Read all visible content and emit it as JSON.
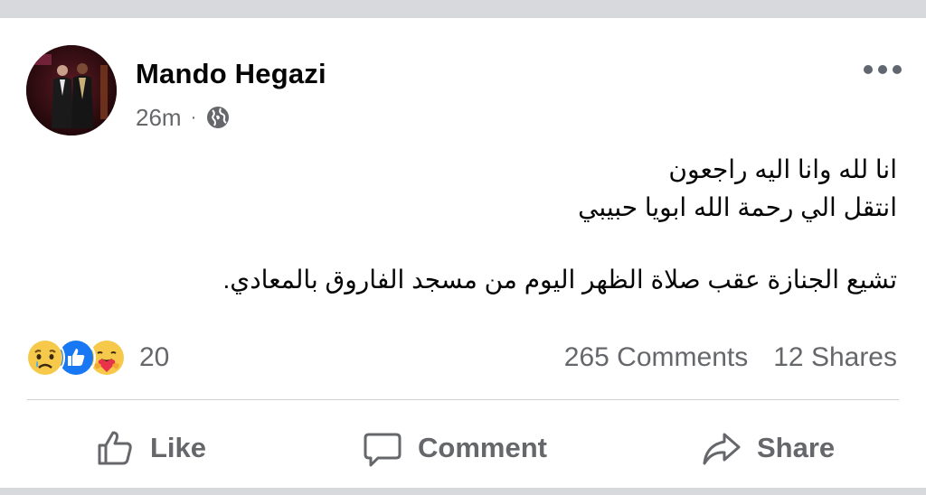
{
  "post": {
    "author_name": "Mando Hegazi",
    "timestamp": "26m",
    "separator": "·",
    "privacy_icon": "globe-icon",
    "more_icon": "more-options-icon",
    "lines": [
      "انا لله وانا اليه راجعون",
      "انتقل الي رحمة الله ابويا حبيبي",
      "",
      "تشيع الجنازة عقب صلاة الظهر اليوم من مسجد الفاروق بالمعادي."
    ]
  },
  "reactions": {
    "icons": [
      "sad-reaction-icon",
      "like-reaction-icon",
      "care-reaction-icon"
    ],
    "count": "20"
  },
  "stats": {
    "comments": "265 Comments",
    "shares": "12 Shares"
  },
  "actions": {
    "like_label": "Like",
    "comment_label": "Comment",
    "share_label": "Share"
  },
  "colors": {
    "text_primary": "#050505",
    "text_secondary": "#65676b",
    "like_blue": "#1877f2",
    "divider": "#ced0d4",
    "bar_gray": "#d7d9dc"
  }
}
